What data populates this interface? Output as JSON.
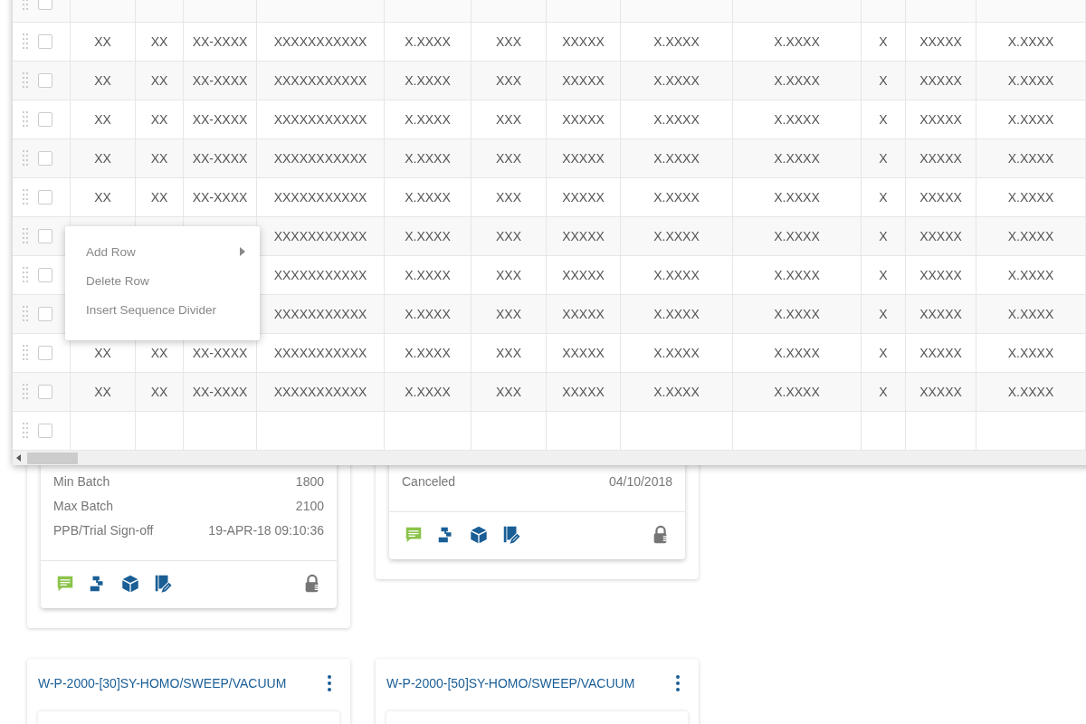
{
  "table": {
    "header_row": {
      "checked": false
    },
    "blank_row": {
      "checked": false
    },
    "rows": [
      {
        "checked": false,
        "cells": [
          "XX",
          "XX",
          "XX-XXXX",
          "XXXXXXXXXXX",
          "X.XXXX",
          "XXX",
          "XXXXX",
          "X.XXXX",
          "X.XXXX",
          "X",
          "XXXXX",
          "X.XXXX"
        ]
      },
      {
        "checked": false,
        "cells": [
          "XX",
          "XX",
          "XX-XXXX",
          "XXXXXXXXXXX",
          "X.XXXX",
          "XXX",
          "XXXXX",
          "X.XXXX",
          "X.XXXX",
          "X",
          "XXXXX",
          "X.XXXX"
        ]
      },
      {
        "checked": false,
        "cells": [
          "XX",
          "XX",
          "XX-XXXX",
          "XXXXXXXXXXX",
          "X.XXXX",
          "XXX",
          "XXXXX",
          "X.XXXX",
          "X.XXXX",
          "X",
          "XXXXX",
          "X.XXXX"
        ]
      },
      {
        "checked": false,
        "cells": [
          "XX",
          "XX",
          "XX-XXXX",
          "XXXXXXXXXXX",
          "X.XXXX",
          "XXX",
          "XXXXX",
          "X.XXXX",
          "X.XXXX",
          "X",
          "XXXXX",
          "X.XXXX"
        ]
      },
      {
        "checked": false,
        "cells": [
          "XX",
          "XX",
          "XX-XXXX",
          "XXXXXXXXXXX",
          "X.XXXX",
          "XXX",
          "XXXXX",
          "X.XXXX",
          "X.XXXX",
          "X",
          "XXXXX",
          "X.XXXX"
        ]
      },
      {
        "checked": false,
        "cells": [
          "XXXXXXXXXXX",
          "X.XXXX",
          "XXX",
          "XXXXX",
          "X.XXXX",
          "X.XXXX",
          "X",
          "XXXXX",
          "X.XXXX"
        ]
      },
      {
        "checked": false,
        "cells": [
          "XXXXXXXXXXX",
          "X.XXXX",
          "XXX",
          "XXXXX",
          "X.XXXX",
          "X.XXXX",
          "X",
          "XXXXX",
          "X.XXXX"
        ]
      },
      {
        "checked": false,
        "cells": [
          "XXXXXXXXXXX",
          "X.XXXX",
          "XXX",
          "XXXXX",
          "X.XXXX",
          "X.XXXX",
          "X",
          "XXXXX",
          "X.XXXX"
        ]
      },
      {
        "checked": false,
        "cells": [
          "XX",
          "XX",
          "XX-XXXX",
          "XXXXXXXXXXX",
          "X.XXXX",
          "XXX",
          "XXXXX",
          "X.XXXX",
          "X.XXXX",
          "X",
          "XXXXX",
          "X.XXXX"
        ]
      },
      {
        "checked": false,
        "cells": [
          "XX",
          "XX",
          "XX-XXXX",
          "XXXXXXXXXXX",
          "X.XXXX",
          "XXX",
          "XXXXX",
          "X.XXXX",
          "X.XXXX",
          "X",
          "XXXXX",
          "X.XXXX"
        ]
      }
    ]
  },
  "context_menu": {
    "items": [
      {
        "label": "Add Row",
        "submenu": true
      },
      {
        "label": "Delete Row",
        "submenu": false
      },
      {
        "label": "Insert Sequence Divider",
        "submenu": false
      }
    ]
  },
  "cards": [
    {
      "rows": [
        {
          "label": "Min Batch",
          "value": "1800"
        },
        {
          "label": "Max Batch",
          "value": "2100"
        },
        {
          "label": "PPB/Trial Sign-off",
          "value": "19-APR-18 09:10:36"
        }
      ]
    },
    {
      "rows": [
        {
          "label": "Canceled",
          "value": "04/10/2018"
        }
      ]
    },
    {
      "title": "W-P-2000-[30]SY-HOMO/SWEEP/VACUUM"
    },
    {
      "title": "W-P-2000-[50]SY-HOMO/SWEEP/VACUUM"
    }
  ]
}
